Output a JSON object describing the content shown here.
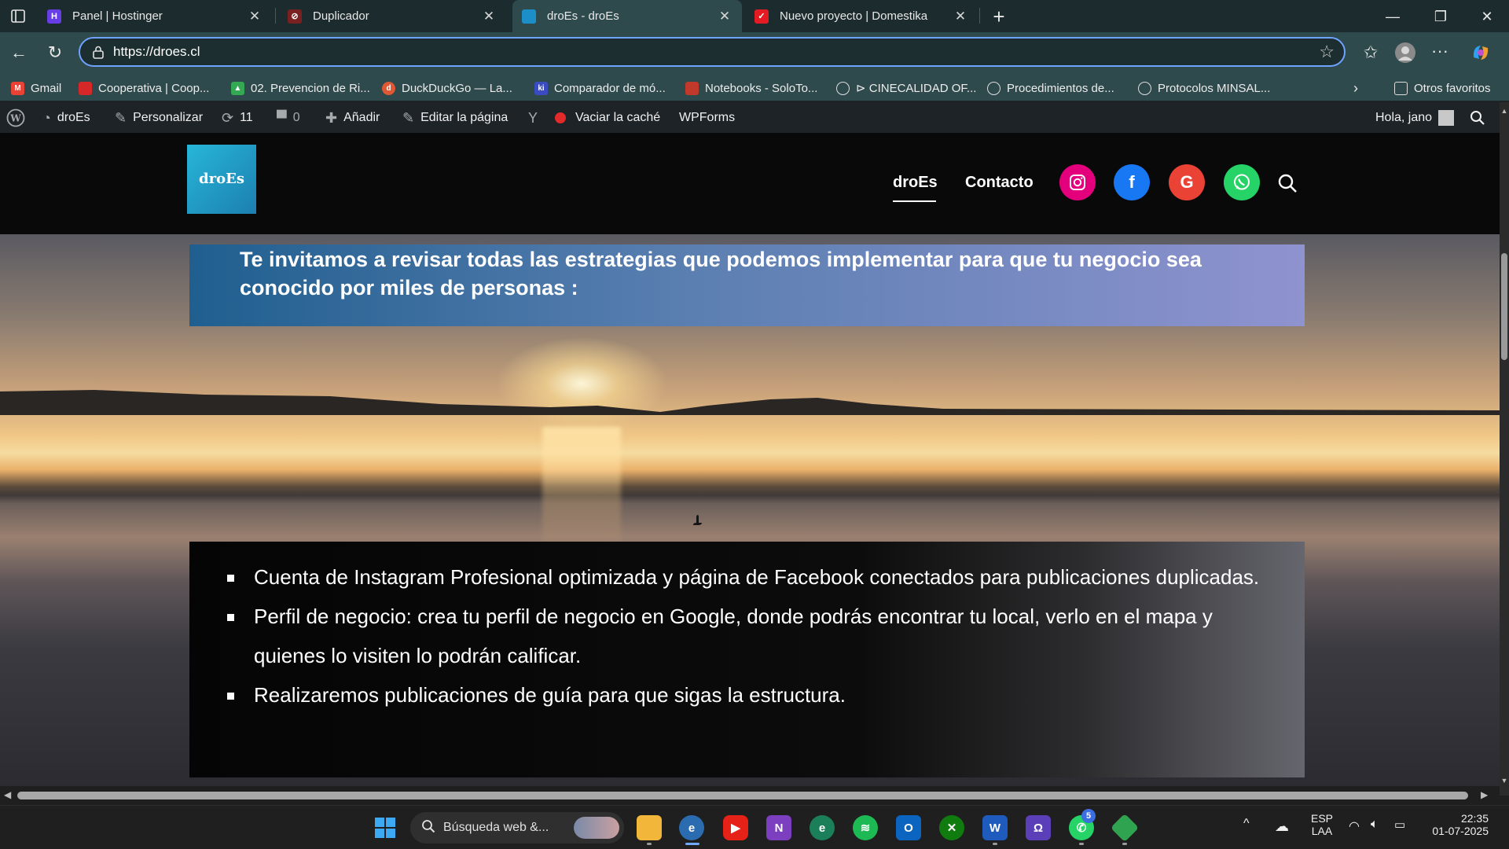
{
  "browser": {
    "tabs": [
      {
        "title": "Panel | Hostinger",
        "icon": "hostinger-icon",
        "color": "#673de6"
      },
      {
        "title": "Duplicador",
        "icon": "duplicator-icon",
        "color": "#c0392b"
      },
      {
        "title": "droEs - droEs",
        "icon": "site-icon",
        "color": "#1c8fc8"
      },
      {
        "title": "Nuevo proyecto | Domestika",
        "icon": "domestika-icon",
        "color": "#e31b23"
      }
    ],
    "address": "https://droes.cl",
    "bookmarks": [
      {
        "label": "Gmail",
        "color": "#ea4335"
      },
      {
        "label": "Cooperativa | Coop...",
        "color": "#d62828"
      },
      {
        "label": "02. Prevencion de Ri...",
        "color": "#34a853"
      },
      {
        "label": "DuckDuckGo — La...",
        "color": "#de5833"
      },
      {
        "label": "Comparador de mó...",
        "color": "#3b4cc0"
      },
      {
        "label": "Notebooks - SoloTo...",
        "color": "#c0392b"
      },
      {
        "label": "⊳ CINECALIDAD OF...",
        "color": "#666666"
      },
      {
        "label": "Procedimientos de...",
        "color": "#666666"
      },
      {
        "label": "Protocolos MINSAL...",
        "color": "#666666"
      }
    ],
    "other_favorites": "Otros favoritos"
  },
  "wpbar": {
    "site": "droEs",
    "customize": "Personalizar",
    "updates": "11",
    "comments": "0",
    "add": "Añadir",
    "edit": "Editar la página",
    "cache": "Vaciar la caché",
    "wpforms": "WPForms",
    "greeting": "Hola, jano"
  },
  "site": {
    "logo_text": "droEs",
    "nav": [
      "droEs",
      "Contacto"
    ],
    "socials": [
      {
        "name": "instagram",
        "color": "#e4007c"
      },
      {
        "name": "facebook",
        "color": "#1877f2"
      },
      {
        "name": "google",
        "color": "#ea4335"
      },
      {
        "name": "whatsapp",
        "color": "#25d366"
      }
    ],
    "intro": "Te invitamos a revisar todas las estrategias que podemos implementar para que tu negocio sea conocido por miles de personas :",
    "list": [
      "Cuenta de Instagram Profesional optimizada y página de Facebook conectados para publicaciones duplicadas.",
      "Perfil de negocio: crea tu perfil de negocio en Google, donde podrás encontrar tu local, verlo en el mapa y quienes lo visiten lo podrán calificar.",
      "Realizaremos publicaciones de guía para que sigas la estructura."
    ]
  },
  "taskbar": {
    "search_placeholder": "Búsqueda web &...",
    "whatsapp_badge": "5",
    "lang": "ESP",
    "layout": "LAA",
    "time": "22:35",
    "date": "01-07-2025"
  }
}
